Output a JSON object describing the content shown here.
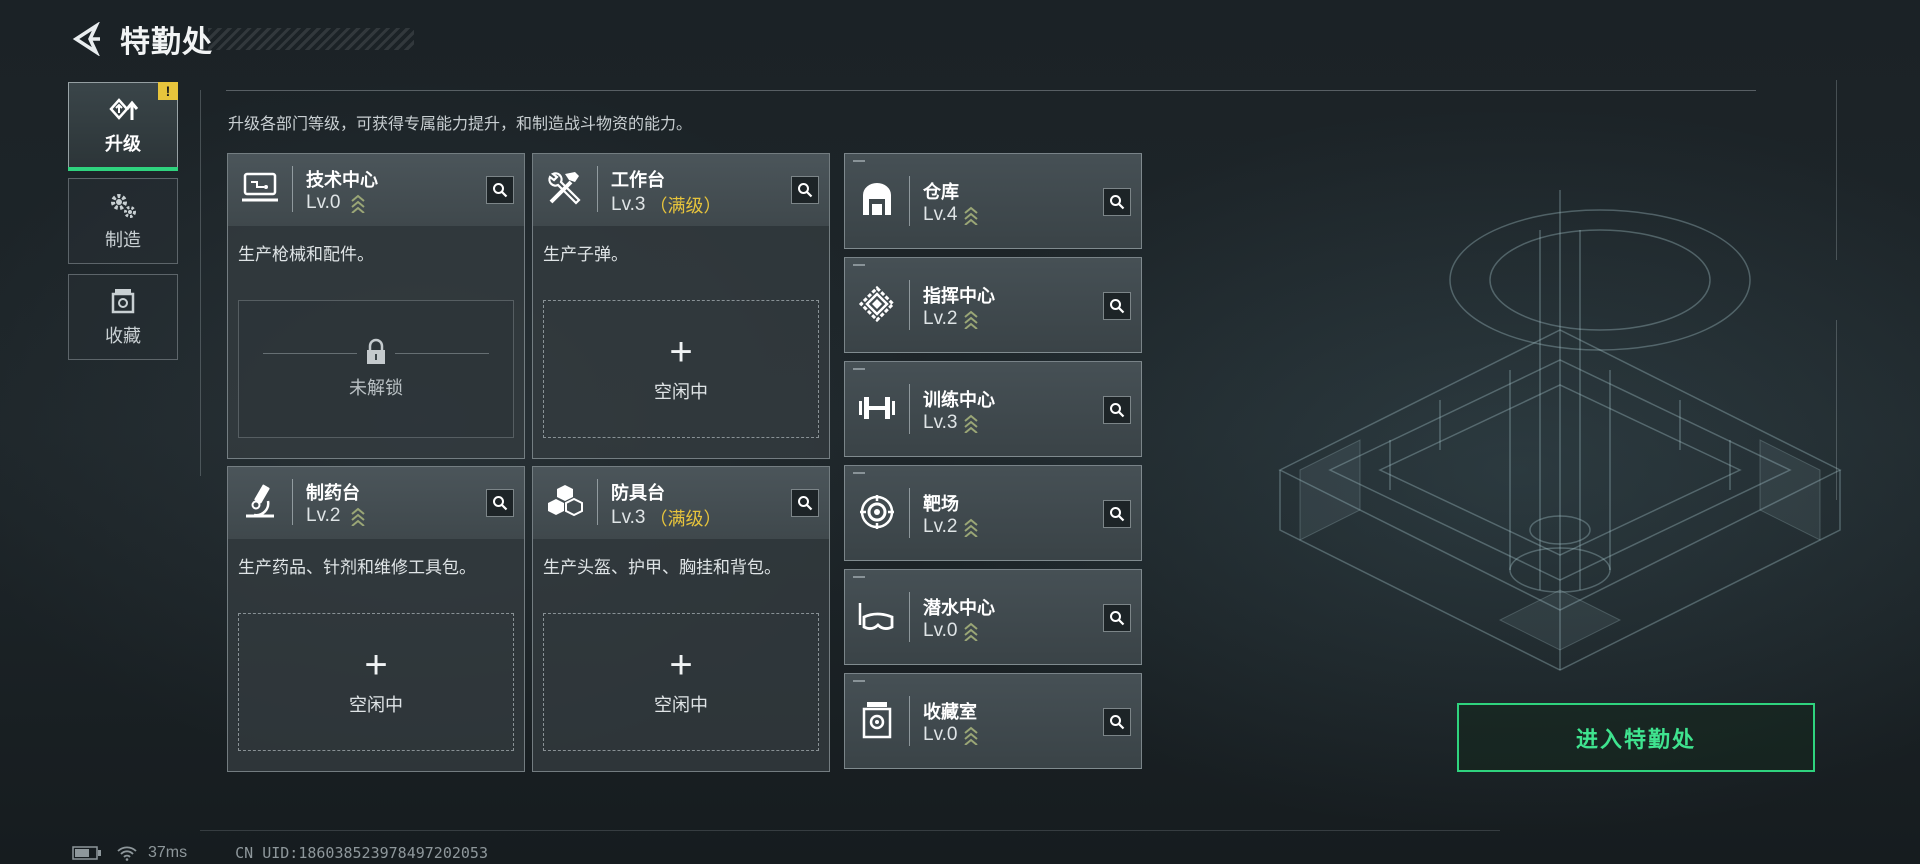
{
  "header": {
    "title": "特勤处",
    "back_icon": "back-arrow-icon"
  },
  "tabs": [
    {
      "label": "升级",
      "icon": "upgrade-icon",
      "active": true,
      "badge": "!"
    },
    {
      "label": "制造",
      "icon": "gears-icon",
      "active": false
    },
    {
      "label": "收藏",
      "icon": "collection-icon",
      "active": false
    }
  ],
  "description": "升级各部门等级，可获得专属能力提升，和制造战斗物资的能力。",
  "cards": [
    {
      "name": "技术中心",
      "level": "Lv.0",
      "max": "",
      "desc": "生产枪械和配件。",
      "slot": "未解锁",
      "slot_state": "locked",
      "icon": "monitor-icon"
    },
    {
      "name": "工作台",
      "level": "Lv.3",
      "max": "（满级）",
      "desc": "生产子弹。",
      "slot": "空闲中",
      "slot_state": "idle",
      "icon": "tools-icon"
    },
    {
      "name": "制药台",
      "level": "Lv.2",
      "max": "",
      "desc": "生产药品、针剂和维修工具包。",
      "slot": "空闲中",
      "slot_state": "idle",
      "icon": "microscope-icon"
    },
    {
      "name": "防具台",
      "level": "Lv.3",
      "max": "（满级）",
      "desc": "生产头盔、护甲、胸挂和背包。",
      "slot": "空闲中",
      "slot_state": "idle",
      "icon": "armor-cubes-icon"
    }
  ],
  "rows": [
    {
      "name": "仓库",
      "level": "Lv.4",
      "icon": "warehouse-icon"
    },
    {
      "name": "指挥中心",
      "level": "Lv.2",
      "icon": "chip-icon"
    },
    {
      "name": "训练中心",
      "level": "Lv.3",
      "icon": "dumbbell-icon"
    },
    {
      "name": "靶场",
      "level": "Lv.2",
      "icon": "target-icon"
    },
    {
      "name": "潜水中心",
      "level": "Lv.0",
      "icon": "diving-mask-icon"
    },
    {
      "name": "收藏室",
      "level": "Lv.0",
      "icon": "vault-icon"
    }
  ],
  "enter_button": "进入特勤处",
  "status": {
    "ping": "37ms",
    "uid": "CN UID:18603852397849720205З"
  },
  "colors": {
    "accent_green": "#2fd37e",
    "max_level_gold": "#e7c43c",
    "badge_yellow": "#e7c43c"
  }
}
